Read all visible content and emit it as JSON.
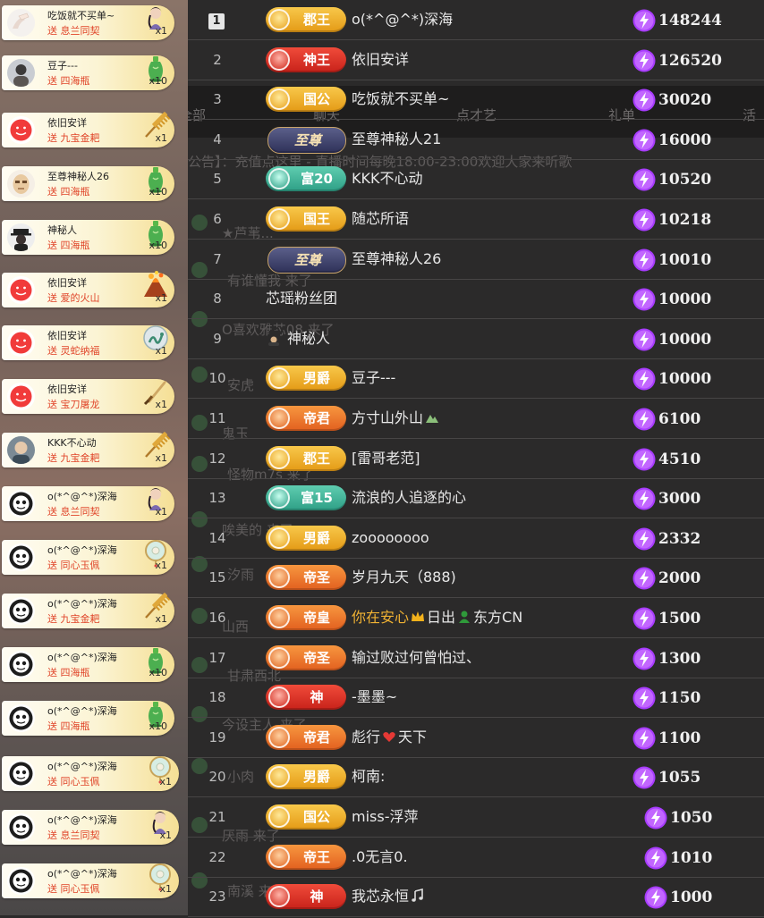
{
  "gift_feed": [
    {
      "name": "吃饭就不买单~",
      "verb": "送",
      "gift": "息兰同契",
      "count": "x1",
      "avatar": "hand",
      "gift_icon": "lady-gift-icon"
    },
    {
      "name": "豆子---",
      "verb": "送",
      "gift": "四海瓶",
      "count": "x10",
      "avatar": "portrait",
      "gift_icon": "vase-gift-icon"
    },
    {
      "name": "依旧安详",
      "verb": "送",
      "gift": "九宝金耙",
      "count": "x1",
      "avatar": "red-face",
      "gift_icon": "rake-gift-icon"
    },
    {
      "name": "至尊神秘人26",
      "verb": "送",
      "gift": "四海瓶",
      "count": "x10",
      "avatar": "mask",
      "gift_icon": "vase-gift-icon"
    },
    {
      "name": "神秘人",
      "verb": "送",
      "gift": "四海瓶",
      "count": "x10",
      "avatar": "hat-man",
      "gift_icon": "vase-gift-icon"
    },
    {
      "name": "依旧安详",
      "verb": "送",
      "gift": "爱的火山",
      "count": "x1",
      "avatar": "red-face",
      "gift_icon": "volcano-gift-icon"
    },
    {
      "name": "依旧安详",
      "verb": "送",
      "gift": "灵蛇纳福",
      "count": "x1",
      "avatar": "red-face",
      "gift_icon": "snake-gift-icon"
    },
    {
      "name": "依旧安详",
      "verb": "送",
      "gift": "宝刀屠龙",
      "count": "x1",
      "avatar": "red-face",
      "gift_icon": "sword-gift-icon"
    },
    {
      "name": "KKK不心动",
      "verb": "送",
      "gift": "九宝金耙",
      "count": "x1",
      "avatar": "portrait2",
      "gift_icon": "rake-gift-icon"
    },
    {
      "name": "o(*^@^*)深海",
      "verb": "送",
      "gift": "息兰同契",
      "count": "x1",
      "avatar": "round-dark",
      "gift_icon": "lady-gift-icon"
    },
    {
      "name": "o(*^@^*)深海",
      "verb": "送",
      "gift": "同心玉佩",
      "count": "x1",
      "avatar": "round-dark",
      "gift_icon": "jade-gift-icon"
    },
    {
      "name": "o(*^@^*)深海",
      "verb": "送",
      "gift": "九宝金耙",
      "count": "x1",
      "avatar": "round-dark",
      "gift_icon": "rake-gift-icon"
    },
    {
      "name": "o(*^@^*)深海",
      "verb": "送",
      "gift": "四海瓶",
      "count": "x10",
      "avatar": "round-dark",
      "gift_icon": "vase-gift-icon"
    },
    {
      "name": "o(*^@^*)深海",
      "verb": "送",
      "gift": "四海瓶",
      "count": "x10",
      "avatar": "round-dark",
      "gift_icon": "vase-gift-icon"
    },
    {
      "name": "o(*^@^*)深海",
      "verb": "送",
      "gift": "同心玉佩",
      "count": "x1",
      "avatar": "round-dark",
      "gift_icon": "jade-gift-icon"
    },
    {
      "name": "o(*^@^*)深海",
      "verb": "送",
      "gift": "息兰同契",
      "count": "x1",
      "avatar": "round-dark",
      "gift_icon": "lady-gift-icon"
    },
    {
      "name": "o(*^@^*)深海",
      "verb": "送",
      "gift": "同心玉佩",
      "count": "x1",
      "avatar": "round-dark",
      "gift_icon": "jade-gift-icon"
    }
  ],
  "ranking": [
    {
      "rank": "1",
      "badge": "郡王",
      "badge_style": "gold",
      "name": "o(*^@^*)深海",
      "score": "148244"
    },
    {
      "rank": "2",
      "badge": "神王",
      "badge_style": "red",
      "name": "依旧安详",
      "score": "126520"
    },
    {
      "rank": "3",
      "badge": "国公",
      "badge_style": "gold",
      "name": "吃饭就不买单~",
      "score": "30020"
    },
    {
      "rank": "4",
      "badge": "至尊",
      "badge_style": "zhizun",
      "name": "至尊神秘人21",
      "score": "16000"
    },
    {
      "rank": "5",
      "badge": "富20",
      "badge_style": "teal",
      "name": "KKK不心动",
      "score": "10520"
    },
    {
      "rank": "6",
      "badge": "国王",
      "badge_style": "gold",
      "name": "随芯所语",
      "score": "10218"
    },
    {
      "rank": "7",
      "badge": "至尊",
      "badge_style": "zhizun",
      "name": "至尊神秘人26",
      "score": "10010"
    },
    {
      "rank": "8",
      "badge": "",
      "badge_style": "none",
      "name": "芯瑶粉丝团",
      "score": "10000"
    },
    {
      "rank": "9",
      "badge": "",
      "badge_style": "mystery",
      "name": "神秘人",
      "score": "10000"
    },
    {
      "rank": "10",
      "badge": "男爵",
      "badge_style": "gold",
      "name": "豆子---",
      "score": "10000"
    },
    {
      "rank": "11",
      "badge": "帝君",
      "badge_style": "orange",
      "name": "方寸山外山",
      "score": "6100",
      "suffix_icon": "mountain-icon"
    },
    {
      "rank": "12",
      "badge": "郡王",
      "badge_style": "gold",
      "name": "[雷哥老范]",
      "score": "4510"
    },
    {
      "rank": "13",
      "badge": "富15",
      "badge_style": "teal",
      "name": "流浪的人追逐的心",
      "score": "3000"
    },
    {
      "rank": "14",
      "badge": "男爵",
      "badge_style": "gold",
      "name": "zoooooooo",
      "score": "2332"
    },
    {
      "rank": "15",
      "badge": "帝圣",
      "badge_style": "orange",
      "name": "岁月九天（888)",
      "score": "2000"
    },
    {
      "rank": "16",
      "badge": "帝皇",
      "badge_style": "orange",
      "name_parts": [
        "你在安心",
        "日出",
        "东方CN"
      ],
      "score": "1500"
    },
    {
      "rank": "17",
      "badge": "帝圣",
      "badge_style": "orange",
      "name": "输过败过何曾怕过、",
      "score": "1300"
    },
    {
      "rank": "18",
      "badge": "神",
      "badge_style": "red",
      "name": "-墨墨~",
      "score": "1150"
    },
    {
      "rank": "19",
      "badge": "帝君",
      "badge_style": "orange",
      "name_parts": [
        "彪行",
        "天下"
      ],
      "score": "1100"
    },
    {
      "rank": "20",
      "badge": "男爵",
      "badge_style": "gold",
      "name": "柯南:",
      "score": "1055"
    },
    {
      "rank": "21",
      "badge": "国公",
      "badge_style": "gold",
      "name": "miss-浮萍",
      "score": "1050"
    },
    {
      "rank": "22",
      "badge": "帝王",
      "badge_style": "orange",
      "name": ".0无言0.",
      "score": "1010"
    },
    {
      "rank": "23",
      "badge": "神",
      "badge_style": "red",
      "name": "我芯永恒",
      "score": "1000",
      "suffix_icon": "music-note-icon"
    }
  ],
  "background_chat": {
    "tabs": [
      "全部",
      "聊天",
      "点才艺",
      "礼单",
      "活"
    ],
    "notice": "公告】：充值点这里 - 直播时间每晚18:00-23:00欢迎大家来听歌",
    "lines": [
      "★芦苇...",
      "有谁懂我 来了",
      "O喜欢雅芯08 来了",
      "安虎",
      "鬼玉",
      "怪物m7s 来了",
      "唉美的 来了",
      "汐雨",
      "山西",
      "甘肃西北",
      "今设主人 来了",
      "小肉",
      "厌雨 来了",
      "南溪 来了"
    ]
  },
  "colors": {
    "background": "#2b2a2a",
    "score_icon": "#a83cff",
    "name_highlight": "#f0b233",
    "gift_text": "#e0452a"
  }
}
